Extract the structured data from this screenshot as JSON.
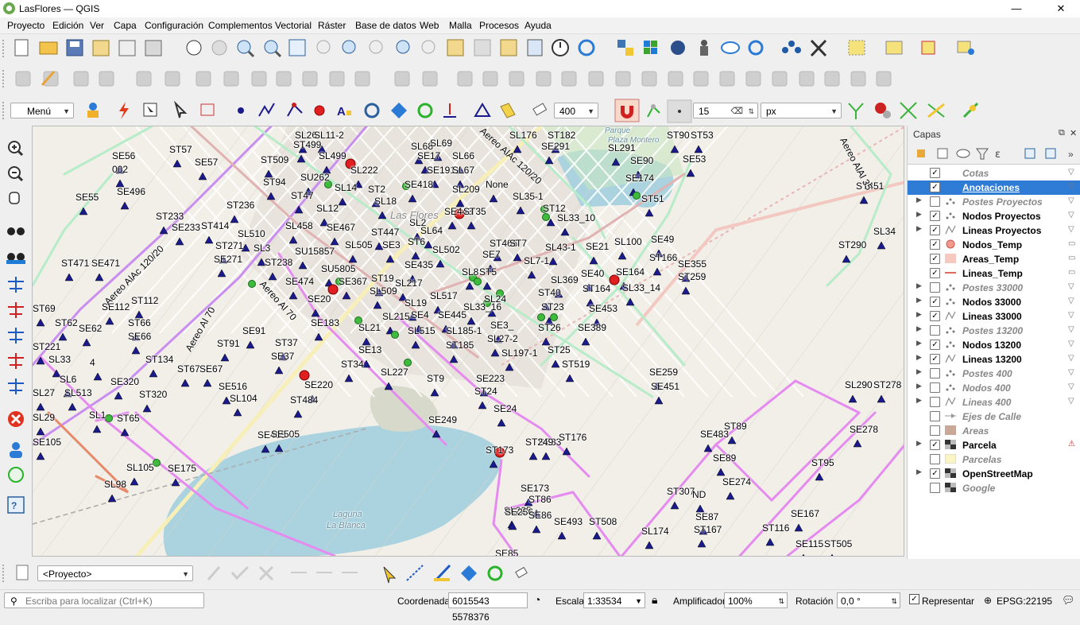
{
  "window": {
    "title": "LasFlores — QGIS"
  },
  "menu": [
    "Proyecto",
    "Edición",
    "Ver",
    "Capa",
    "Configuración",
    "Complementos",
    "Vectorial",
    "Ráster",
    "Base de datos",
    "Web",
    "Malla",
    "Procesos",
    "Ayuda"
  ],
  "toolbar3": {
    "menu_combo": "Menú",
    "scale_combo": "400",
    "snap_tolerance": "15",
    "snap_unit": "px"
  },
  "panel": {
    "title": "Capas",
    "layers": [
      {
        "name": "Cotas",
        "checked": true,
        "on": false,
        "sym": "none",
        "expand": false
      },
      {
        "name": "Anotaciones",
        "checked": true,
        "on": true,
        "sym": "none",
        "expand": false,
        "selected": true
      },
      {
        "name": "Postes Proyectos",
        "checked": false,
        "on": false,
        "sym": "points",
        "expand": true
      },
      {
        "name": "Nodos Proyectos",
        "checked": true,
        "on": true,
        "sym": "points",
        "expand": true
      },
      {
        "name": "Lineas Proyectos",
        "checked": true,
        "on": true,
        "sym": "lines",
        "expand": true
      },
      {
        "name": "Nodos_Temp",
        "checked": true,
        "on": true,
        "sym": "redcircle",
        "expand": false
      },
      {
        "name": "Areas_Temp",
        "checked": true,
        "on": true,
        "sym": "pinkfill",
        "expand": false
      },
      {
        "name": "Lineas_Temp",
        "checked": true,
        "on": true,
        "sym": "redline",
        "expand": false
      },
      {
        "name": "Postes 33000",
        "checked": false,
        "on": false,
        "sym": "points",
        "expand": true
      },
      {
        "name": "Nodos 33000",
        "checked": true,
        "on": true,
        "sym": "points",
        "expand": true
      },
      {
        "name": "Lineas 33000",
        "checked": true,
        "on": true,
        "sym": "lines",
        "expand": true
      },
      {
        "name": "Postes 13200",
        "checked": false,
        "on": false,
        "sym": "points",
        "expand": true
      },
      {
        "name": "Nodos 13200",
        "checked": true,
        "on": true,
        "sym": "points",
        "expand": true
      },
      {
        "name": "Lineas 13200",
        "checked": true,
        "on": true,
        "sym": "lines",
        "expand": true
      },
      {
        "name": "Postes 400",
        "checked": false,
        "on": false,
        "sym": "points",
        "expand": true
      },
      {
        "name": "Nodos 400",
        "checked": false,
        "on": false,
        "sym": "points",
        "expand": true
      },
      {
        "name": "Lineas 400",
        "checked": false,
        "on": false,
        "sym": "lines",
        "expand": true
      },
      {
        "name": "Ejes de Calle",
        "checked": false,
        "on": false,
        "sym": "arrowline",
        "expand": false
      },
      {
        "name": "Areas",
        "checked": false,
        "on": false,
        "sym": "brownfill",
        "expand": false
      },
      {
        "name": "Parcela",
        "checked": true,
        "on": true,
        "sym": "raster",
        "expand": true
      },
      {
        "name": "Parcelas",
        "checked": false,
        "on": false,
        "sym": "yellowfill",
        "expand": false
      },
      {
        "name": "OpenStreetMap",
        "checked": true,
        "on": true,
        "sym": "raster",
        "expand": true
      },
      {
        "name": "Google",
        "checked": false,
        "on": false,
        "sym": "raster",
        "expand": false
      }
    ]
  },
  "bottom": {
    "project_combo": "<Proyecto>"
  },
  "status": {
    "search_placeholder": "Escriba para localizar (Ctrl+K)",
    "coord_label": "Coordenada",
    "coord_value": "6015543  5578376",
    "scale_label": "Escala",
    "scale_value": "1:33534",
    "magnifier_label": "Amplificador",
    "magnifier_value": "100%",
    "rotation_label": "Rotación",
    "rotation_value": "0,0 °",
    "render_label": "Representar",
    "crs": "EPSG:22195"
  },
  "map_labels": {
    "town": "Las Flores",
    "water1": "Laguna",
    "water2": "La Blanca",
    "park1": "Parque",
    "park2": "Plaza Montero",
    "lines": [
      "Aereo AlAc 120/20",
      "Aereo AlAc 120/20",
      "Aereo Al 70",
      "Aereo Al 70",
      "Aereo AlAl 35"
    ],
    "points": [
      "SL26",
      "SL11-2",
      "ST499",
      "SL499",
      "SE56",
      "002",
      "ST57",
      "SE57",
      "ST509",
      "ST94",
      "SE55",
      "SE496",
      "SL222",
      "SE418",
      "SL14",
      "SU262",
      "ST2",
      "SL18",
      "ST233",
      "SE233",
      "ST236",
      "ST47",
      "SL12",
      "ST414",
      "SL510",
      "SL458",
      "SE467",
      "ST447",
      "SL505",
      "SE3",
      "ST271",
      "SE271",
      "SL3",
      "SU15857",
      "SE474",
      "SU5805",
      "SE367",
      "ST238",
      "ST471",
      "SE471",
      "SL2",
      "SL64",
      "ST6",
      "SL502",
      "SE435",
      "ST19",
      "SL217",
      "SL509",
      "SE20",
      "SL8",
      "ST5",
      "SL517",
      "ST112",
      "SE112",
      "SL19",
      "SE4",
      "SE445",
      "SL215",
      "ST69",
      "ST66",
      "SE66",
      "SE183",
      "SL21",
      "SL515",
      "SL185-1",
      "ST62",
      "SE62",
      "ST91",
      "SE91",
      "ST37",
      "SE37",
      "SE13",
      "ST185",
      "ST221",
      "SL33",
      "4",
      "SL6",
      "ST134",
      "ST34",
      "SL227",
      "ST9",
      "ST67",
      "SE67",
      "SE320",
      "ST320",
      "SE516",
      "SL104",
      "SE220",
      "ST484",
      "SE249",
      "SL27",
      "SL513",
      "SL1",
      "ST65",
      "SL29",
      "SE105",
      "SE405",
      "SL105",
      "SE175",
      "SL98",
      "SL68",
      "SL69",
      "SE17",
      "SL66",
      "SE191",
      "SL67",
      "SL209",
      "None",
      "SE443",
      "ST35",
      "SL35-1",
      "ST12",
      "SL33_10",
      "ST466",
      "ST7",
      "SE7",
      "SL7-1",
      "SL43-1",
      "SE21",
      "SL369",
      "ST40",
      "SE40",
      "ST164",
      "SE164",
      "SL33_14",
      "SL33_16",
      "SL24",
      "ST23",
      "ST26",
      "SE389",
      "SE453",
      "SE3_",
      "SL27-2",
      "SL197-1",
      "ST25",
      "ST519",
      "SE223",
      "ST24",
      "SE24",
      "SE33",
      "ST249",
      "ST176",
      "ST173",
      "SE173",
      "SL225",
      "SE256",
      "ST86",
      "SE86",
      "SE493",
      "ST508",
      "SE85",
      "SL176",
      "ST182",
      "SE291",
      "SL291",
      "SE90",
      "ST90",
      "ST53",
      "SE53",
      "SE174",
      "ST51",
      "SL100",
      "SE49",
      "ST166",
      "SE355",
      "ST259",
      "SE259",
      "SE451",
      "ST451",
      "SL34",
      "ST290",
      "SL290",
      "ST278",
      "SE278",
      "SE483",
      "ST89",
      "SE89",
      "ST95",
      "SE274",
      "ST307",
      "ND",
      "SE87",
      "ST167",
      "SE167",
      "SL174",
      "ST116",
      "SE115",
      "ST505",
      "SE505"
    ]
  }
}
